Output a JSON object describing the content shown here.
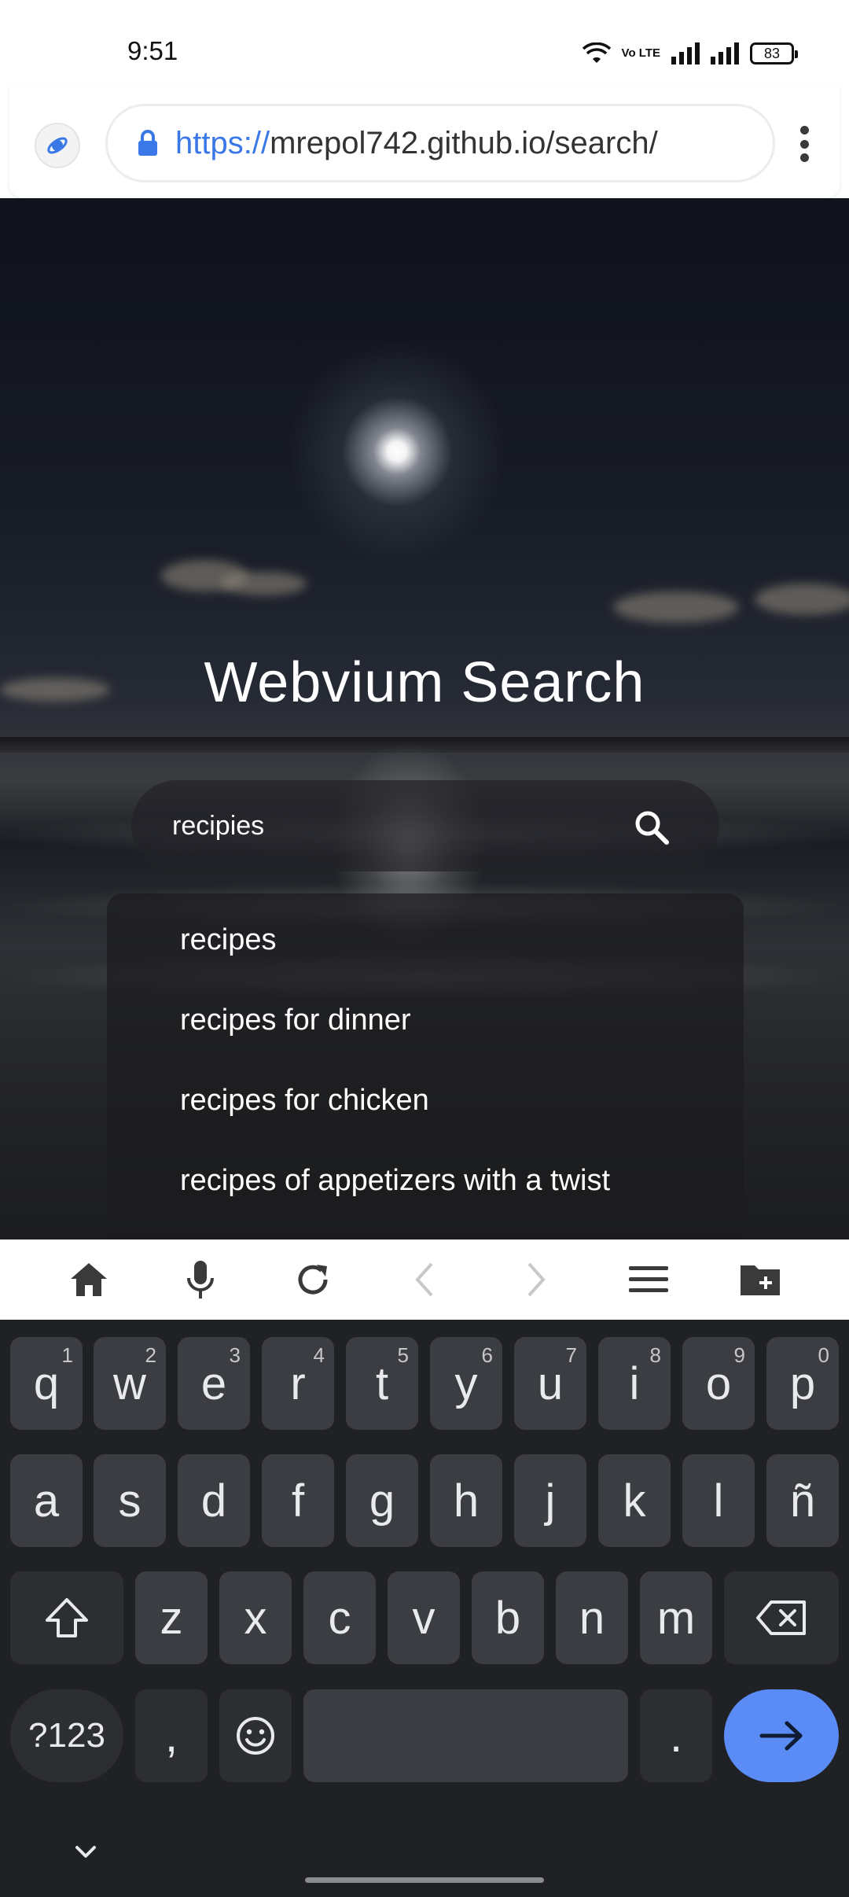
{
  "status_bar": {
    "time": "9:51",
    "volte_label": "Vo LTE",
    "battery": "83"
  },
  "browser": {
    "url_scheme": "https://",
    "url_rest": "mrepol742.github.io/search/"
  },
  "page": {
    "title": "Webvium Search",
    "search_query": "recipies",
    "suggestions": [
      "recipes",
      "recipes for dinner",
      "recipes for chicken",
      "recipes of appetizers with a twist"
    ]
  },
  "bottom_toolbar": {
    "icons": [
      "home-icon",
      "microphone-icon",
      "refresh-icon",
      "back-icon",
      "forward-icon",
      "hamburger-menu-icon",
      "folder-add-icon"
    ]
  },
  "keyboard": {
    "row1": [
      {
        "key": "q",
        "hint": "1"
      },
      {
        "key": "w",
        "hint": "2"
      },
      {
        "key": "e",
        "hint": "3"
      },
      {
        "key": "r",
        "hint": "4"
      },
      {
        "key": "t",
        "hint": "5"
      },
      {
        "key": "y",
        "hint": "6"
      },
      {
        "key": "u",
        "hint": "7"
      },
      {
        "key": "i",
        "hint": "8"
      },
      {
        "key": "o",
        "hint": "9"
      },
      {
        "key": "p",
        "hint": "0"
      }
    ],
    "row2": [
      "a",
      "s",
      "d",
      "f",
      "g",
      "h",
      "j",
      "k",
      "l",
      "ñ"
    ],
    "row3": [
      "z",
      "x",
      "c",
      "v",
      "b",
      "n",
      "m"
    ],
    "symbols_label": "?123",
    "comma_label": ",",
    "period_label": "."
  },
  "colors": {
    "url_blue": "#3b78e7",
    "keyboard_bg": "#202125",
    "key_bg": "#3c3d42",
    "enter_blue": "#5b8cf5"
  }
}
